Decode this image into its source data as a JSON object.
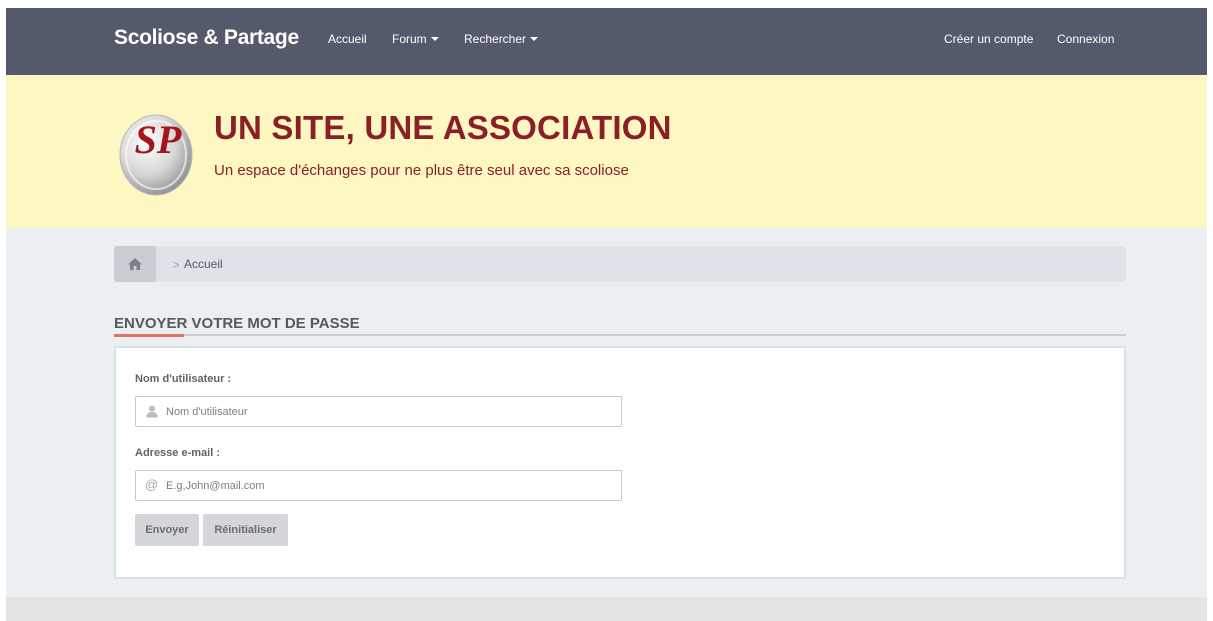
{
  "navbar": {
    "brand": "Scoliose & Partage",
    "links": [
      {
        "label": "Accueil",
        "dropdown": false
      },
      {
        "label": "Forum",
        "dropdown": true
      },
      {
        "label": "Rechercher",
        "dropdown": true
      }
    ],
    "right_links": [
      {
        "label": "Créer un compte"
      },
      {
        "label": "Connexion"
      }
    ]
  },
  "banner": {
    "logo_text": "SP",
    "title": "UN SITE, UNE ASSOCIATION",
    "subtitle": "Un espace d'échanges pour ne plus être seul avec sa scoliose"
  },
  "breadcrumb": {
    "home_icon": "home-icon",
    "items": [
      "Accueil"
    ]
  },
  "page": {
    "heading": "ENVOYER VOTRE MOT DE PASSE"
  },
  "form": {
    "username": {
      "label": "Nom d'utilisateur :",
      "placeholder": "Nom d'utilisateur",
      "value": "",
      "icon": "user-icon"
    },
    "email": {
      "label": "Adresse e-mail :",
      "placeholder": "E.g,John@mail.com",
      "value": "",
      "icon": "at-icon"
    },
    "submit_label": "Envoyer",
    "reset_label": "Réinitialiser"
  },
  "colors": {
    "navbar": "#545a6b",
    "banner_bg": "#fdf7c2",
    "banner_text": "#8a1f27",
    "accent": "#e0745e",
    "page_bg": "#eceff1"
  }
}
